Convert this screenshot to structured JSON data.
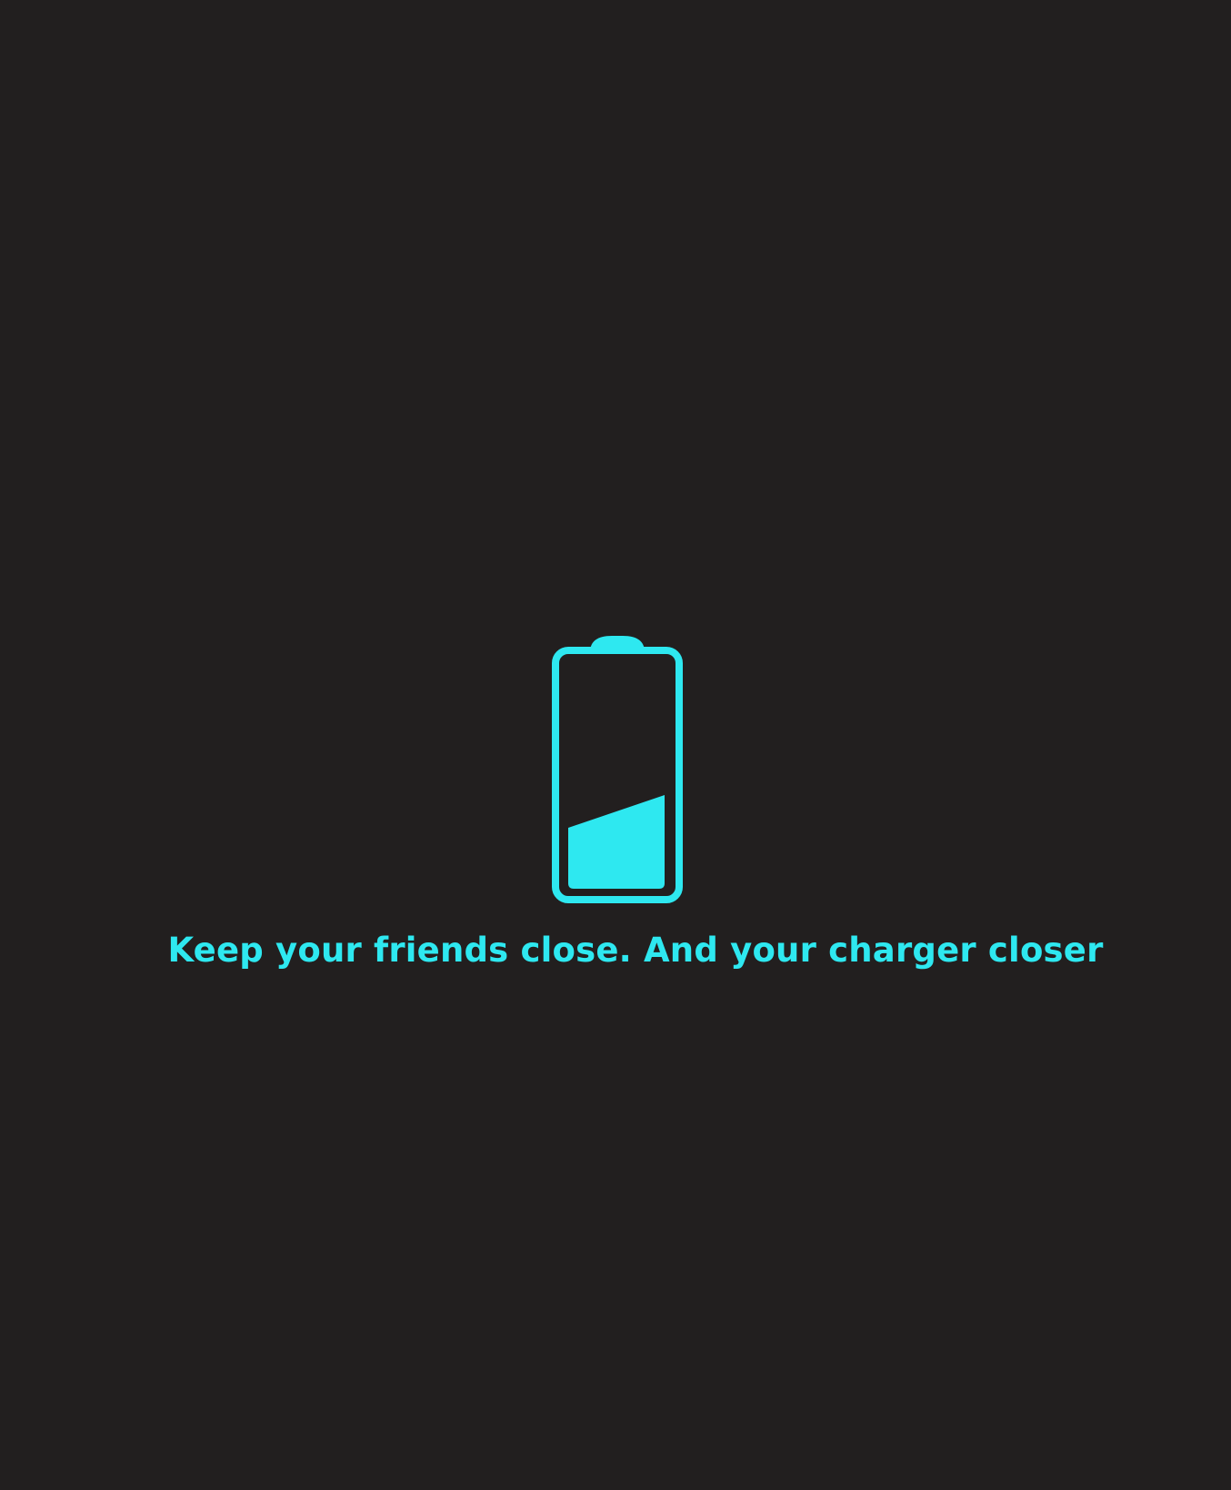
{
  "battery": {
    "icon": "battery-low-icon",
    "level_fraction": 0.3
  },
  "message": {
    "text": "Keep your friends close. And your charger closer"
  },
  "colors": {
    "background": "#221f1f",
    "accent": "#2ee8f0"
  }
}
